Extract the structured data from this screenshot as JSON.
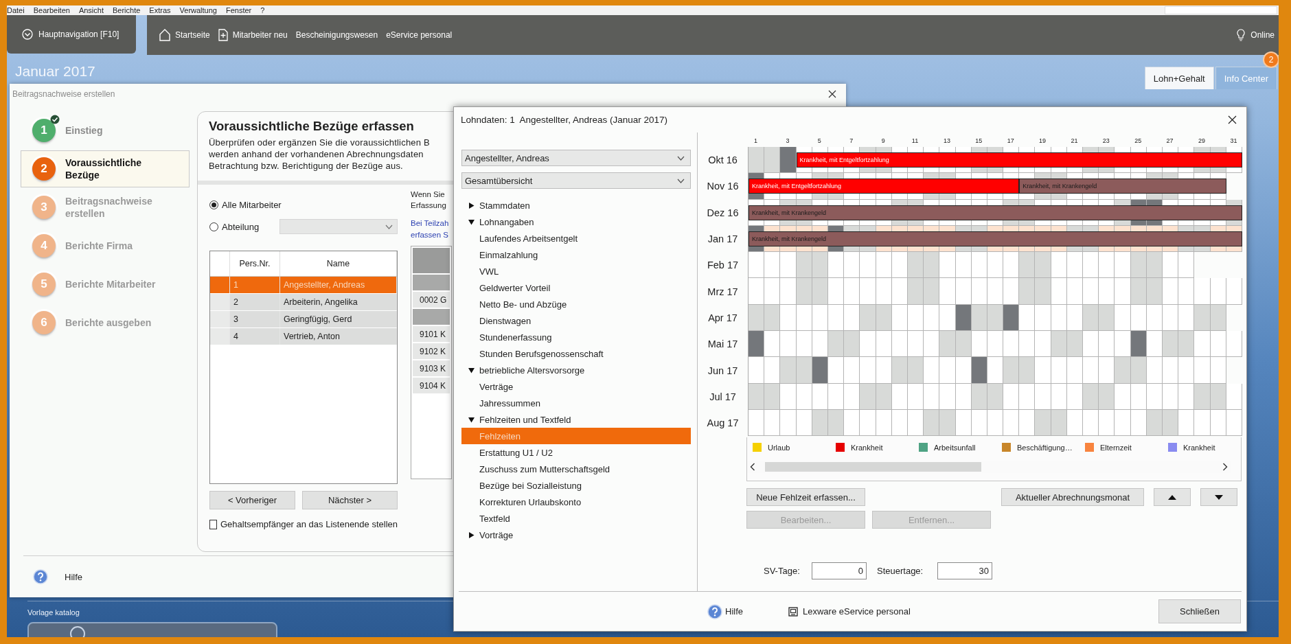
{
  "menu": [
    "Datei",
    "Bearbeiten",
    "Ansicht",
    "Berichte",
    "Extras",
    "Verwaltung",
    "Fenster",
    "?"
  ],
  "navigation": {
    "main_button": "Hauptnavigation [F10]",
    "links": [
      {
        "label": "Startseite",
        "kind": "home"
      },
      {
        "label": "Mitarbeiter neu",
        "kind": "add"
      },
      {
        "label": "Bescheinigungswesen",
        "kind": "plain"
      },
      {
        "label": "eService personal",
        "kind": "plain"
      }
    ],
    "status": "Online"
  },
  "header": {
    "period": "Januar 2017",
    "tabs": [
      {
        "label": "Lohn+Gehalt",
        "selected": true
      },
      {
        "label": "Info Center",
        "selected": false
      }
    ],
    "badge": "2"
  },
  "bottom": {
    "section": "Vorlage katalog"
  },
  "wizard": {
    "title": "Beitragsnachweise erstellen",
    "steps": [
      {
        "number": "1",
        "label": "Einstieg",
        "completed": true,
        "selected": false
      },
      {
        "number": "2",
        "label": "Voraussichtliche Bezüge",
        "completed": false,
        "selected": true
      },
      {
        "number": "3",
        "label": "Beitragsnachweise erstellen",
        "completed": false,
        "selected": false
      },
      {
        "number": "4",
        "label": "Berichte Firma",
        "completed": false,
        "selected": false
      },
      {
        "number": "5",
        "label": "Berichte Mitarbeiter",
        "completed": false,
        "selected": false
      },
      {
        "number": "6",
        "label": "Berichte ausgeben",
        "completed": false,
        "selected": false
      }
    ],
    "heading": "Voraussichtliche Bezüge erfassen",
    "description": [
      "Überprüfen oder ergänzen Sie die voraussichtlichen B",
      "werden anhand der vorhandenen Abrechnungsdaten",
      "Betrachtung bzw. Berichtigung der Bezüge aus."
    ],
    "filter": [
      {
        "label": "Alle Mitarbeiter",
        "selected": true
      },
      {
        "label": "Abteilung",
        "selected": false
      }
    ],
    "department": {
      "disabled": true
    },
    "employees": {
      "columns": [
        "Pers.Nr.",
        "Name"
      ],
      "rows": [
        {
          "nr": "1",
          "name": "Angestellter, Andreas",
          "selected": true
        },
        {
          "nr": "2",
          "name": "Arbeiterin, Angelika",
          "selected": false
        },
        {
          "nr": "3",
          "name": "Geringfügig, Gerd",
          "selected": false
        },
        {
          "nr": "4",
          "name": "Vertrieb, Anton",
          "selected": false
        }
      ]
    },
    "buttons": [
      "< Vorheriger",
      "Nächster >"
    ],
    "sort_option": {
      "label": "Gehaltsempfänger an das Listenende stellen",
      "checked": false
    },
    "hint": [
      "Wenn Sie",
      "Erfassung"
    ],
    "links": [
      "Bei Teilzah",
      "erfassen S"
    ],
    "side_table": [
      {
        "kind": "header"
      },
      {
        "kind": "group"
      },
      {
        "kind": "item",
        "text": "0002 G"
      },
      {
        "kind": "group"
      },
      {
        "kind": "item",
        "text": "9101 K"
      },
      {
        "kind": "item",
        "text": "9102 K"
      },
      {
        "kind": "item",
        "text": "9103 K"
      },
      {
        "kind": "item",
        "text": "9104 K"
      }
    ],
    "help": "Hilfe"
  },
  "lohndaten": {
    "title": "Lohndaten: 1  Angestellter, Andreas (Januar 2017)",
    "employee_select": "Angestellter, Andreas",
    "view_select": "Gesamtübersicht",
    "tree": [
      {
        "label": "Stammdaten",
        "expanded": false,
        "selected": false
      },
      {
        "label": "Lohnangaben",
        "expanded": true,
        "selected": false,
        "children": [
          {
            "label": "Laufendes Arbeitsentgelt",
            "selected": false
          },
          {
            "label": "Einmalzahlung",
            "selected": false
          },
          {
            "label": "VWL",
            "selected": false
          },
          {
            "label": "Geldwerter Vorteil",
            "selected": false
          },
          {
            "label": "Netto Be- und Abzüge",
            "selected": false
          },
          {
            "label": "Dienstwagen",
            "selected": false
          },
          {
            "label": "Stundenerfassung",
            "selected": false
          },
          {
            "label": "Stunden Berufsgenossenschaft",
            "selected": false
          }
        ]
      },
      {
        "label": "betriebliche Altersvorsorge",
        "expanded": true,
        "selected": false,
        "children": [
          {
            "label": "Verträge",
            "selected": false
          },
          {
            "label": "Jahressummen",
            "selected": false
          }
        ]
      },
      {
        "label": "Fehlzeiten und Textfeld",
        "expanded": true,
        "selected": false,
        "children": [
          {
            "label": "Fehlzeiten",
            "selected": true
          },
          {
            "label": "Erstattung U1 / U2",
            "selected": false
          },
          {
            "label": "Zuschuss zum Mutterschaftsgeld",
            "selected": false
          },
          {
            "label": "Bezüge bei Sozialleistung",
            "selected": false
          },
          {
            "label": "Korrekturen Urlaubskonto",
            "selected": false
          },
          {
            "label": "Textfeld",
            "selected": false
          }
        ]
      },
      {
        "label": "Vorträge",
        "expanded": false,
        "selected": false
      }
    ],
    "calendar": {
      "day_labels": [
        "1",
        "3",
        "5",
        "7",
        "9",
        "11",
        "13",
        "15",
        "17",
        "19",
        "21",
        "23",
        "25",
        "27",
        "29",
        "31"
      ],
      "months": [
        {
          "label": "Okt 16",
          "current": false,
          "segments": [
            {
              "days": [
                {
                  "kind": "weekend"
                },
                {
                  "kind": "weekend"
                },
                {
                  "kind": "holiday"
                }
              ]
            },
            {
              "absence": "Krankheit, mit Entgeltfortzahlung",
              "color": "#ff0000",
              "days": [
                {
                  "kind": "workday"
                },
                {
                  "kind": "workday"
                },
                {
                  "kind": "workday"
                },
                {
                  "kind": "workday"
                },
                {
                  "kind": "weekend"
                },
                {
                  "kind": "weekend"
                },
                {
                  "kind": "workday"
                },
                {
                  "kind": "workday"
                },
                {
                  "kind": "workday"
                },
                {
                  "kind": "workday"
                },
                {
                  "kind": "workday"
                },
                {
                  "kind": "weekend"
                },
                {
                  "kind": "weekend"
                },
                {
                  "kind": "workday"
                },
                {
                  "kind": "workday"
                },
                {
                  "kind": "workday"
                },
                {
                  "kind": "workday"
                },
                {
                  "kind": "workday"
                },
                {
                  "kind": "weekend"
                },
                {
                  "kind": "weekend"
                },
                {
                  "kind": "workday"
                },
                {
                  "kind": "workday"
                },
                {
                  "kind": "workday"
                },
                {
                  "kind": "workday"
                },
                {
                  "kind": "workday"
                },
                {
                  "kind": "weekend"
                },
                {
                  "kind": "weekend"
                },
                {
                  "kind": "workday"
                }
              ]
            }
          ]
        },
        {
          "label": "Nov 16",
          "current": false,
          "segments": [
            {
              "absence": "Krankheit, mit Entgeltfortzahlung",
              "color": "#ff0000",
              "days": [
                {
                  "kind": "holiday"
                },
                {
                  "kind": "workday"
                },
                {
                  "kind": "workday"
                },
                {
                  "kind": "workday"
                },
                {
                  "kind": "weekend"
                },
                {
                  "kind": "weekend"
                },
                {
                  "kind": "workday"
                },
                {
                  "kind": "workday"
                },
                {
                  "kind": "workday"
                },
                {
                  "kind": "workday"
                },
                {
                  "kind": "workday"
                },
                {
                  "kind": "weekend"
                },
                {
                  "kind": "weekend"
                },
                {
                  "kind": "workday"
                },
                {
                  "kind": "workday"
                },
                {
                  "kind": "workday"
                },
                {
                  "kind": "workday"
                }
              ]
            },
            {
              "absence": "Krankheit, mit Krankengeld",
              "color": "#8c5b5b",
              "days": [
                {
                  "kind": "workday"
                },
                {
                  "kind": "weekend"
                },
                {
                  "kind": "weekend"
                },
                {
                  "kind": "workday"
                },
                {
                  "kind": "workday"
                },
                {
                  "kind": "workday"
                },
                {
                  "kind": "workday"
                },
                {
                  "kind": "workday"
                },
                {
                  "kind": "weekend"
                },
                {
                  "kind": "weekend"
                },
                {
                  "kind": "workday"
                },
                {
                  "kind": "workday"
                },
                {
                  "kind": "workday"
                }
              ]
            }
          ]
        },
        {
          "label": "Dez 16",
          "current": false,
          "segments": [
            {
              "absence": "Krankheit, mit Krankengeld",
              "color": "#8c5b5b",
              "days": [
                {
                  "kind": "workday"
                },
                {
                  "kind": "workday"
                },
                {
                  "kind": "weekend"
                },
                {
                  "kind": "weekend"
                },
                {
                  "kind": "workday"
                },
                {
                  "kind": "workday"
                },
                {
                  "kind": "workday"
                },
                {
                  "kind": "workday"
                },
                {
                  "kind": "workday"
                },
                {
                  "kind": "weekend"
                },
                {
                  "kind": "weekend"
                },
                {
                  "kind": "workday"
                },
                {
                  "kind": "workday"
                },
                {
                  "kind": "workday"
                },
                {
                  "kind": "workday"
                },
                {
                  "kind": "workday"
                },
                {
                  "kind": "weekend"
                },
                {
                  "kind": "weekend"
                },
                {
                  "kind": "workday"
                },
                {
                  "kind": "workday"
                },
                {
                  "kind": "workday"
                },
                {
                  "kind": "workday"
                },
                {
                  "kind": "workday"
                },
                {
                  "kind": "weekend"
                },
                {
                  "kind": "holiday"
                },
                {
                  "kind": "holiday"
                },
                {
                  "kind": "workday"
                },
                {
                  "kind": "workday"
                },
                {
                  "kind": "workday"
                },
                {
                  "kind": "workday"
                },
                {
                  "kind": "weekend"
                }
              ]
            }
          ]
        },
        {
          "label": "Jan 17",
          "current": true,
          "segments": [
            {
              "absence": "Krankheit, mit Krankengeld",
              "color": "#8c5b5b",
              "days": [
                {
                  "kind": "holiday"
                },
                {
                  "kind": "workday"
                },
                {
                  "kind": "workday"
                },
                {
                  "kind": "workday"
                },
                {
                  "kind": "workday"
                },
                {
                  "kind": "holiday"
                },
                {
                  "kind": "weekend"
                },
                {
                  "kind": "weekend"
                },
                {
                  "kind": "workday"
                },
                {
                  "kind": "workday"
                },
                {
                  "kind": "workday"
                },
                {
                  "kind": "workday"
                },
                {
                  "kind": "workday"
                },
                {
                  "kind": "weekend"
                },
                {
                  "kind": "weekend"
                },
                {
                  "kind": "workday"
                },
                {
                  "kind": "workday"
                },
                {
                  "kind": "workday"
                },
                {
                  "kind": "workday"
                },
                {
                  "kind": "workday"
                },
                {
                  "kind": "weekend"
                },
                {
                  "kind": "weekend"
                },
                {
                  "kind": "workday"
                },
                {
                  "kind": "workday"
                },
                {
                  "kind": "workday"
                },
                {
                  "kind": "workday"
                },
                {
                  "kind": "workday"
                },
                {
                  "kind": "weekend"
                },
                {
                  "kind": "weekend"
                },
                {
                  "kind": "workday"
                },
                {
                  "kind": "workday"
                }
              ]
            }
          ]
        },
        {
          "label": "Feb 17",
          "current": false,
          "segments": [
            {
              "days": [
                {
                  "kind": "workday"
                },
                {
                  "kind": "workday"
                },
                {
                  "kind": "workday"
                },
                {
                  "kind": "weekend"
                },
                {
                  "kind": "weekend"
                },
                {
                  "kind": "workday"
                },
                {
                  "kind": "workday"
                },
                {
                  "kind": "workday"
                },
                {
                  "kind": "workday"
                },
                {
                  "kind": "workday"
                },
                {
                  "kind": "weekend"
                },
                {
                  "kind": "weekend"
                },
                {
                  "kind": "workday"
                },
                {
                  "kind": "workday"
                },
                {
                  "kind": "workday"
                },
                {
                  "kind": "workday"
                },
                {
                  "kind": "workday"
                },
                {
                  "kind": "weekend"
                },
                {
                  "kind": "weekend"
                },
                {
                  "kind": "workday"
                },
                {
                  "kind": "workday"
                },
                {
                  "kind": "workday"
                },
                {
                  "kind": "workday"
                },
                {
                  "kind": "workday"
                },
                {
                  "kind": "weekend"
                },
                {
                  "kind": "weekend"
                },
                {
                  "kind": "workday"
                },
                {
                  "kind": "workday"
                }
              ]
            }
          ]
        },
        {
          "label": "Mrz 17",
          "current": false,
          "segments": [
            {
              "days": [
                {
                  "kind": "workday"
                },
                {
                  "kind": "workday"
                },
                {
                  "kind": "workday"
                },
                {
                  "kind": "weekend"
                },
                {
                  "kind": "weekend"
                },
                {
                  "kind": "workday"
                },
                {
                  "kind": "workday"
                },
                {
                  "kind": "workday"
                },
                {
                  "kind": "workday"
                },
                {
                  "kind": "workday"
                },
                {
                  "kind": "weekend"
                },
                {
                  "kind": "weekend"
                },
                {
                  "kind": "workday"
                },
                {
                  "kind": "workday"
                },
                {
                  "kind": "workday"
                },
                {
                  "kind": "workday"
                },
                {
                  "kind": "workday"
                },
                {
                  "kind": "weekend"
                },
                {
                  "kind": "weekend"
                },
                {
                  "kind": "workday"
                },
                {
                  "kind": "workday"
                },
                {
                  "kind": "workday"
                },
                {
                  "kind": "workday"
                },
                {
                  "kind": "workday"
                },
                {
                  "kind": "weekend"
                },
                {
                  "kind": "weekend"
                },
                {
                  "kind": "workday"
                },
                {
                  "kind": "workday"
                },
                {
                  "kind": "workday"
                },
                {
                  "kind": "workday"
                },
                {
                  "kind": "workday"
                }
              ]
            }
          ]
        },
        {
          "label": "Apr 17",
          "current": false,
          "segments": [
            {
              "days": [
                {
                  "kind": "weekend"
                },
                {
                  "kind": "weekend"
                },
                {
                  "kind": "workday"
                },
                {
                  "kind": "workday"
                },
                {
                  "kind": "workday"
                },
                {
                  "kind": "workday"
                },
                {
                  "kind": "workday"
                },
                {
                  "kind": "weekend"
                },
                {
                  "kind": "weekend"
                },
                {
                  "kind": "workday"
                },
                {
                  "kind": "workday"
                },
                {
                  "kind": "workday"
                },
                {
                  "kind": "workday"
                },
                {
                  "kind": "holiday"
                },
                {
                  "kind": "weekend"
                },
                {
                  "kind": "weekend"
                },
                {
                  "kind": "holiday"
                },
                {
                  "kind": "workday"
                },
                {
                  "kind": "workday"
                },
                {
                  "kind": "workday"
                },
                {
                  "kind": "workday"
                },
                {
                  "kind": "weekend"
                },
                {
                  "kind": "weekend"
                },
                {
                  "kind": "workday"
                },
                {
                  "kind": "workday"
                },
                {
                  "kind": "workday"
                },
                {
                  "kind": "workday"
                },
                {
                  "kind": "workday"
                },
                {
                  "kind": "weekend"
                },
                {
                  "kind": "weekend"
                }
              ]
            }
          ]
        },
        {
          "label": "Mai 17",
          "current": false,
          "segments": [
            {
              "days": [
                {
                  "kind": "holiday"
                },
                {
                  "kind": "workday"
                },
                {
                  "kind": "workday"
                },
                {
                  "kind": "workday"
                },
                {
                  "kind": "workday"
                },
                {
                  "kind": "weekend"
                },
                {
                  "kind": "weekend"
                },
                {
                  "kind": "workday"
                },
                {
                  "kind": "workday"
                },
                {
                  "kind": "workday"
                },
                {
                  "kind": "workday"
                },
                {
                  "kind": "workday"
                },
                {
                  "kind": "weekend"
                },
                {
                  "kind": "weekend"
                },
                {
                  "kind": "workday"
                },
                {
                  "kind": "workday"
                },
                {
                  "kind": "workday"
                },
                {
                  "kind": "workday"
                },
                {
                  "kind": "workday"
                },
                {
                  "kind": "weekend"
                },
                {
                  "kind": "weekend"
                },
                {
                  "kind": "workday"
                },
                {
                  "kind": "workday"
                },
                {
                  "kind": "workday"
                },
                {
                  "kind": "holiday"
                },
                {
                  "kind": "workday"
                },
                {
                  "kind": "weekend"
                },
                {
                  "kind": "weekend"
                },
                {
                  "kind": "workday"
                },
                {
                  "kind": "workday"
                },
                {
                  "kind": "workday"
                }
              ]
            }
          ]
        },
        {
          "label": "Jun 17",
          "current": false,
          "segments": [
            {
              "days": [
                {
                  "kind": "workday"
                },
                {
                  "kind": "workday"
                },
                {
                  "kind": "weekend"
                },
                {
                  "kind": "weekend"
                },
                {
                  "kind": "holiday"
                },
                {
                  "kind": "workday"
                },
                {
                  "kind": "workday"
                },
                {
                  "kind": "workday"
                },
                {
                  "kind": "workday"
                },
                {
                  "kind": "weekend"
                },
                {
                  "kind": "weekend"
                },
                {
                  "kind": "workday"
                },
                {
                  "kind": "workday"
                },
                {
                  "kind": "workday"
                },
                {
                  "kind": "holiday"
                },
                {
                  "kind": "workday"
                },
                {
                  "kind": "weekend"
                },
                {
                  "kind": "weekend"
                },
                {
                  "kind": "workday"
                },
                {
                  "kind": "workday"
                },
                {
                  "kind": "workday"
                },
                {
                  "kind": "workday"
                },
                {
                  "kind": "workday"
                },
                {
                  "kind": "weekend"
                },
                {
                  "kind": "weekend"
                },
                {
                  "kind": "workday"
                },
                {
                  "kind": "workday"
                },
                {
                  "kind": "workday"
                },
                {
                  "kind": "workday"
                },
                {
                  "kind": "workday"
                }
              ]
            }
          ]
        },
        {
          "label": "Jul 17",
          "current": false,
          "segments": [
            {
              "days": [
                {
                  "kind": "weekend"
                },
                {
                  "kind": "weekend"
                },
                {
                  "kind": "workday"
                },
                {
                  "kind": "workday"
                },
                {
                  "kind": "workday"
                },
                {
                  "kind": "workday"
                },
                {
                  "kind": "workday"
                },
                {
                  "kind": "weekend"
                },
                {
                  "kind": "weekend"
                },
                {
                  "kind": "workday"
                },
                {
                  "kind": "workday"
                },
                {
                  "kind": "workday"
                },
                {
                  "kind": "workday"
                },
                {
                  "kind": "workday"
                },
                {
                  "kind": "weekend"
                },
                {
                  "kind": "weekend"
                },
                {
                  "kind": "workday"
                },
                {
                  "kind": "workday"
                },
                {
                  "kind": "workday"
                },
                {
                  "kind": "workday"
                },
                {
                  "kind": "workday"
                },
                {
                  "kind": "weekend"
                },
                {
                  "kind": "weekend"
                },
                {
                  "kind": "workday"
                },
                {
                  "kind": "workday"
                },
                {
                  "kind": "workday"
                },
                {
                  "kind": "workday"
                },
                {
                  "kind": "workday"
                },
                {
                  "kind": "weekend"
                },
                {
                  "kind": "weekend"
                },
                {
                  "kind": "workday"
                }
              ]
            }
          ]
        },
        {
          "label": "Aug 17",
          "current": false,
          "segments": [
            {
              "days": [
                {
                  "kind": "workday"
                },
                {
                  "kind": "workday"
                },
                {
                  "kind": "workday"
                },
                {
                  "kind": "workday"
                },
                {
                  "kind": "weekend"
                },
                {
                  "kind": "weekend"
                },
                {
                  "kind": "workday"
                },
                {
                  "kind": "workday"
                },
                {
                  "kind": "workday"
                },
                {
                  "kind": "workday"
                },
                {
                  "kind": "workday"
                },
                {
                  "kind": "weekend"
                },
                {
                  "kind": "weekend"
                },
                {
                  "kind": "workday"
                },
                {
                  "kind": "workday"
                },
                {
                  "kind": "workday"
                },
                {
                  "kind": "workday"
                },
                {
                  "kind": "workday"
                },
                {
                  "kind": "weekend"
                },
                {
                  "kind": "weekend"
                },
                {
                  "kind": "workday"
                },
                {
                  "kind": "workday"
                },
                {
                  "kind": "workday"
                },
                {
                  "kind": "workday"
                },
                {
                  "kind": "workday"
                },
                {
                  "kind": "weekend"
                },
                {
                  "kind": "weekend"
                },
                {
                  "kind": "workday"
                },
                {
                  "kind": "workday"
                },
                {
                  "kind": "workday"
                },
                {
                  "kind": "workday"
                }
              ]
            }
          ]
        }
      ]
    },
    "legend": [
      {
        "label": "Urlaub",
        "color": "#f5d000"
      },
      {
        "label": "Krankheit",
        "color": "#e60000"
      },
      {
        "label": "Arbeitsunfall",
        "color": "#4fa384"
      },
      {
        "label": "Beschäftigung…",
        "color": "#c8862a"
      },
      {
        "label": "Elternzeit",
        "color": "#f8843f"
      },
      {
        "label": "Krankheit",
        "color": "#8a8cf0"
      }
    ],
    "actions": [
      {
        "label": "Neue Fehlzeit erfassen...",
        "disabled": false
      },
      {
        "label": "Aktueller Abrechnungsmonat",
        "disabled": false
      }
    ],
    "edit_actions": [
      {
        "label": "Bearbeiten...",
        "disabled": true
      },
      {
        "label": "Entfernen...",
        "disabled": true
      }
    ],
    "day_counts": [
      {
        "label": "SV-Tage:",
        "value": "0"
      },
      {
        "label": "Steuertage:",
        "value": "30"
      }
    ],
    "footer": {
      "help": "Hilfe",
      "service": "Lexware eService personal",
      "close": "Schließen"
    }
  }
}
